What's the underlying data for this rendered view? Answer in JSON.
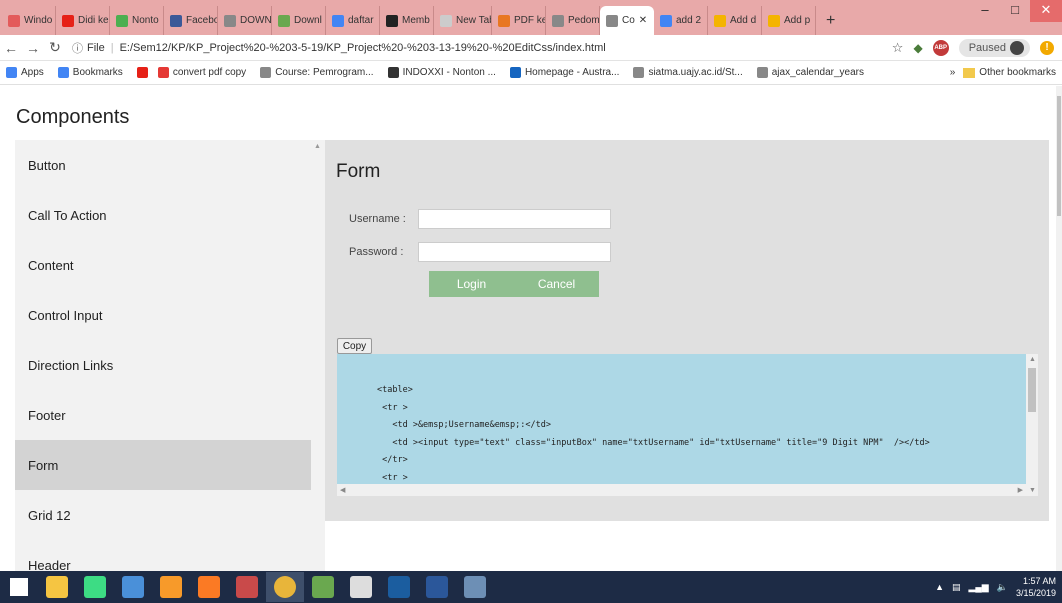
{
  "browser": {
    "tabs": [
      {
        "label": "Windo",
        "color": "#e35b5b"
      },
      {
        "label": "Didi ke",
        "color": "#e62117"
      },
      {
        "label": "Nonto",
        "color": "#4caf50"
      },
      {
        "label": "Facebo",
        "color": "#3b5998"
      },
      {
        "label": "DOWN",
        "color": "#888888"
      },
      {
        "label": "Downl",
        "color": "#6aa84f"
      },
      {
        "label": "daftar",
        "color": "#4285f4"
      },
      {
        "label": "Memb",
        "color": "#222222"
      },
      {
        "label": "New Tab",
        "color": "#cccccc"
      },
      {
        "label": "PDF ke",
        "color": "#e87722"
      },
      {
        "label": "Pedom",
        "color": "#888888"
      },
      {
        "label": "Co",
        "color": "#888888"
      },
      {
        "label": "add 2",
        "color": "#4285f4"
      },
      {
        "label": "Add d",
        "color": "#f4b400"
      },
      {
        "label": "Add p",
        "color": "#f4b400"
      }
    ],
    "new_tab_label": "+",
    "window_controls": {
      "minimize": "–",
      "maximize": "□",
      "close": "✕"
    },
    "url_scheme": "File",
    "url": "E:/Sem12/KP/KP_Project%20-%203-5-19/KP_Project%20-%203-13-19%20-%20EditCss/index.html",
    "paused_label": "Paused",
    "abp_label": "ABP",
    "bookmarks": [
      {
        "label": "Apps",
        "color": "#4285f4"
      },
      {
        "label": "Bookmarks",
        "color": "#4285f4"
      },
      {
        "label": "",
        "color": "#e62117"
      },
      {
        "label": "convert pdf copy",
        "color": "#e53935"
      },
      {
        "label": "Course: Pemrogram...",
        "color": "#888888"
      },
      {
        "label": "INDOXXI - Nonton ...",
        "color": "#333333"
      },
      {
        "label": "Homepage - Austra...",
        "color": "#1565c0"
      },
      {
        "label": "siatma.uajy.ac.id/St...",
        "color": "#888888"
      },
      {
        "label": "ajax_calendar_years",
        "color": "#888888"
      }
    ],
    "more_bookmarks": "»",
    "other_bookmarks": "Other bookmarks"
  },
  "page": {
    "heading": "Components",
    "sidebar_items": [
      "Button",
      "Call To Action",
      "Content",
      "Control Input",
      "Direction Links",
      "Footer",
      "Form",
      "Grid 12",
      "Header"
    ],
    "active_item": "Form",
    "form": {
      "title": "Form",
      "username_label": "Username   :",
      "password_label": "Password   :",
      "username_value": "",
      "password_value": "",
      "login_label": "Login",
      "cancel_label": "Cancel"
    },
    "copy_label": "Copy",
    "code_lines": [
      "<table>",
      " <tr >",
      "   <td >&emsp;Username&emsp;:</td>",
      "   <td ><input type=\"text\" class=\"inputBox\" name=\"txtUsername\" id=\"txtUsername\" title=\"9 Digit NPM\"  /></td>",
      " </tr>",
      " <tr >"
    ]
  },
  "taskbar": {
    "apps": [
      {
        "name": "windows-start",
        "color": "#ffffff"
      },
      {
        "name": "file-explorer",
        "color": "#f5c542"
      },
      {
        "name": "android-studio",
        "color": "#3ddc84"
      },
      {
        "name": "app-4",
        "color": "#4a90d9"
      },
      {
        "name": "sublime-text",
        "color": "#f79a2a"
      },
      {
        "name": "xampp",
        "color": "#fb7a24"
      },
      {
        "name": "sql-server",
        "color": "#c94a4a"
      },
      {
        "name": "chrome",
        "color": "#e8b53a"
      },
      {
        "name": "app-9",
        "color": "#6aa84f"
      },
      {
        "name": "app-10",
        "color": "#dddddd"
      },
      {
        "name": "steam",
        "color": "#1b5d9f"
      },
      {
        "name": "app-12",
        "color": "#2b579a"
      },
      {
        "name": "app-13",
        "color": "#6d8fb5"
      }
    ],
    "active_app": "chrome",
    "time": "1:57 AM",
    "date": "3/15/2019"
  }
}
